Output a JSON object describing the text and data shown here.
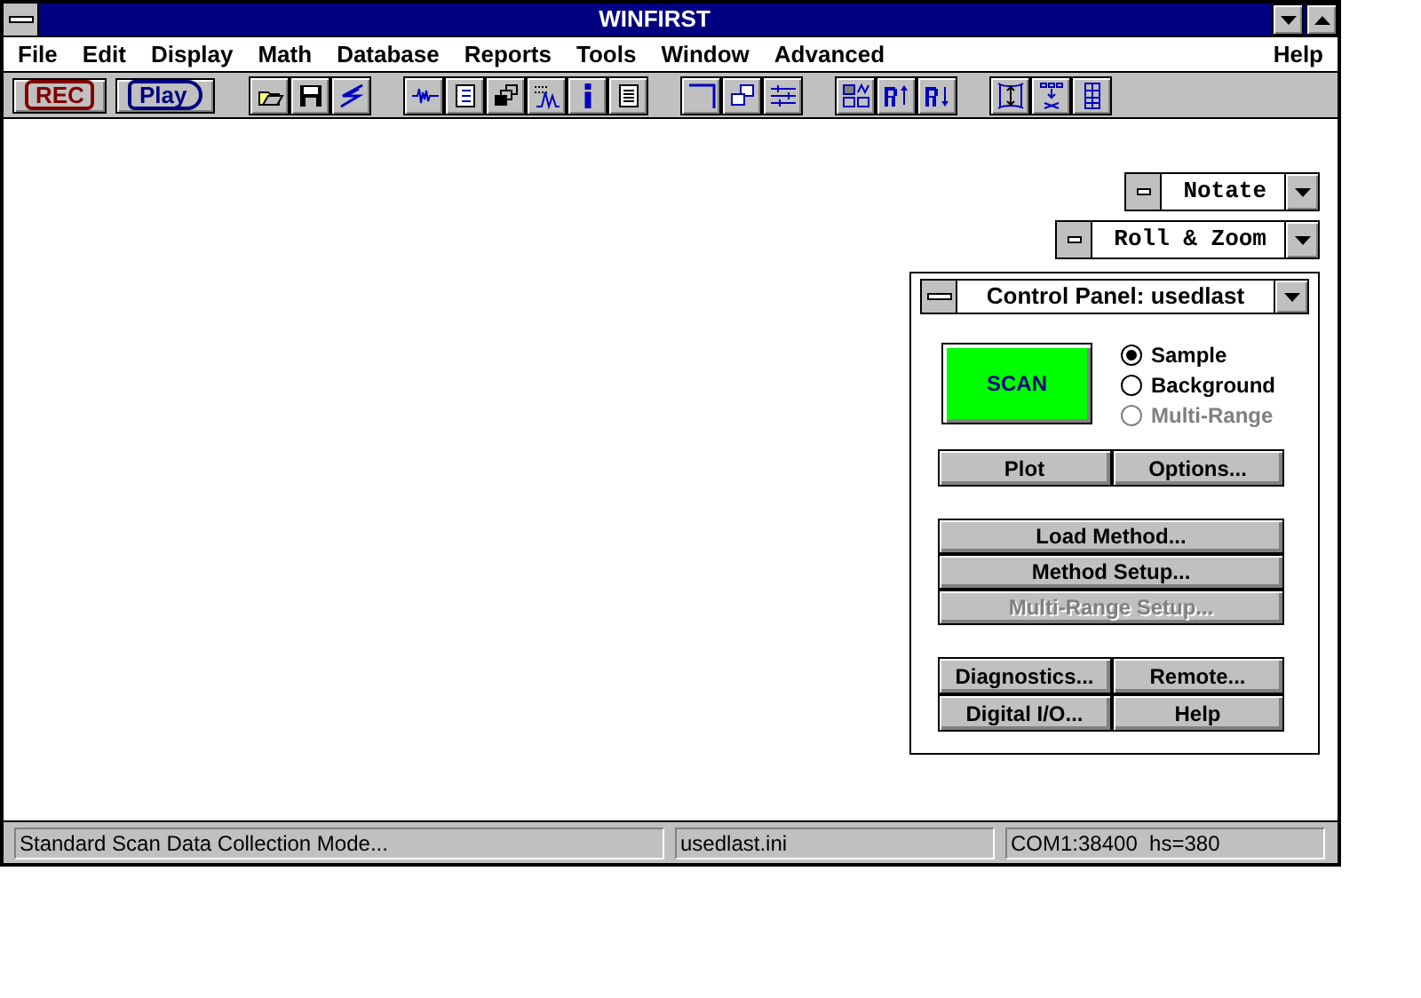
{
  "window": {
    "title": "WINFIRST"
  },
  "menu": [
    {
      "label": "File"
    },
    {
      "label": "Edit"
    },
    {
      "label": "Display"
    },
    {
      "label": "Math"
    },
    {
      "label": "Database"
    },
    {
      "label": "Reports"
    },
    {
      "label": "Tools"
    },
    {
      "label": "Window"
    },
    {
      "label": "Advanced"
    }
  ],
  "menu_right": [
    {
      "label": "Help"
    }
  ],
  "toolbar": {
    "buttons": [
      {
        "label": "REC",
        "kind": "rec"
      },
      {
        "label": "Play",
        "kind": "play"
      }
    ]
  },
  "tool_windows": [
    {
      "title": "Notate"
    },
    {
      "title": "Roll & Zoom"
    }
  ],
  "control_panel": {
    "title": "Control Panel: usedlast",
    "scan_button": "SCAN",
    "modes": [
      {
        "label": "Sample",
        "selected": true,
        "disabled": false
      },
      {
        "label": "Background",
        "selected": false,
        "disabled": false
      },
      {
        "label": "Multi-Range",
        "selected": false,
        "disabled": true
      }
    ],
    "button_groups": [
      {
        "kind": "pair",
        "buttons": [
          {
            "label": "Plot",
            "disabled": false
          },
          {
            "label": "Options...",
            "disabled": false
          }
        ]
      },
      {
        "kind": "stack",
        "buttons": [
          {
            "label": "Load Method...",
            "disabled": false
          },
          {
            "label": "Method Setup...",
            "disabled": false
          },
          {
            "label": "Multi-Range Setup...",
            "disabled": true
          }
        ]
      },
      {
        "kind": "pair",
        "buttons": [
          {
            "label": "Diagnostics...",
            "disabled": false
          },
          {
            "label": "Remote...",
            "disabled": false
          },
          {
            "label": "Digital I/O...",
            "disabled": false
          },
          {
            "label": "Help",
            "disabled": false
          }
        ]
      }
    ]
  },
  "status_bar": [
    "Standard Scan Data Collection Mode...",
    "usedlast.ini",
    "COM1:38400  hs=380"
  ]
}
